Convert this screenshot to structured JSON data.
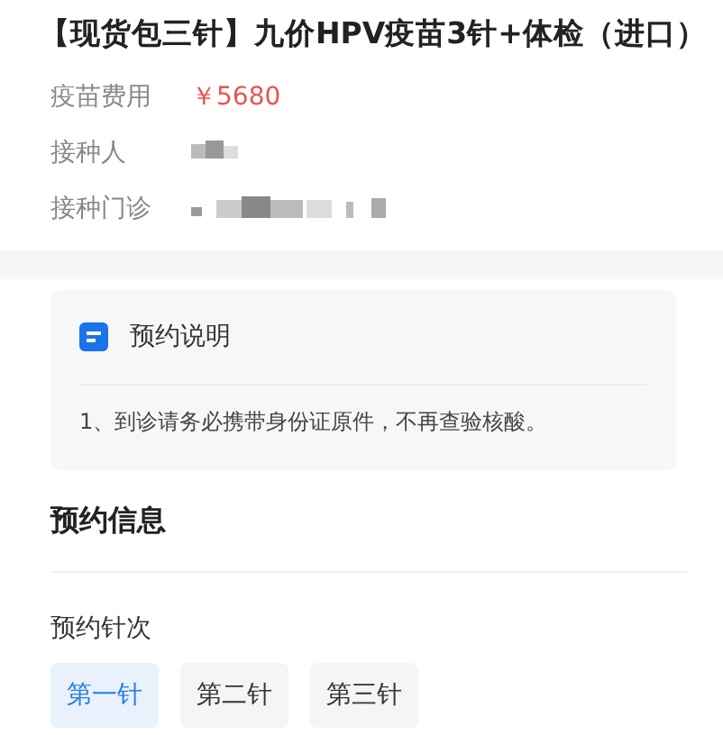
{
  "product": {
    "title": "【现货包三针】九价HPV疫苗3针+体检（进口）"
  },
  "fields": [
    {
      "label": "疫苗费用",
      "kind": "price",
      "value": "￥5680"
    },
    {
      "label": "接种人",
      "kind": "redacted"
    },
    {
      "label": "接种门诊",
      "kind": "redacted"
    }
  ],
  "notice": {
    "title": "预约说明",
    "items": [
      "1、到诊请务必携带身份证原件，不再查验核酸。"
    ]
  },
  "booking": {
    "title": "预约信息",
    "dose_label": "预约针次",
    "doses": [
      {
        "label": "第一针",
        "selected": true
      },
      {
        "label": "第二针",
        "selected": false
      },
      {
        "label": "第三针",
        "selected": false
      }
    ]
  }
}
